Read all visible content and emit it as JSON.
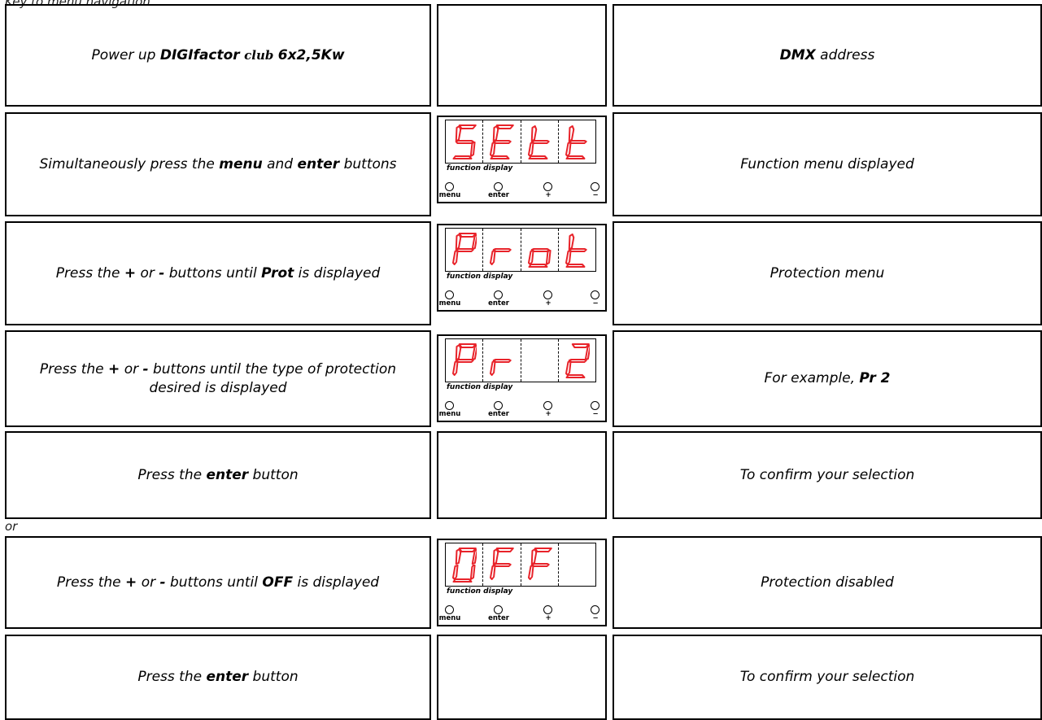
{
  "header": {
    "text": "Key to menu navigation"
  },
  "panel_labels": {
    "function_display": "function display",
    "menu": "menu",
    "enter": "enter",
    "plus": "+",
    "minus": "−"
  },
  "separator": {
    "text": "or"
  },
  "display_colors": {
    "segment": "#e8232a"
  },
  "rows": [
    {
      "left": {
        "pre": "Power up ",
        "b1": "DIGIfactor",
        "mid": " ",
        "club": "club",
        "mid2": " ",
        "b2": "6x2,5Kw",
        "post": ""
      },
      "right": {
        "pre": "",
        "b1": "DMX",
        "post": " address"
      }
    },
    {
      "left": {
        "pre": "Simultaneously press the ",
        "b1": "menu",
        "mid": " and ",
        "b2": "enter",
        "post": " buttons"
      },
      "display": [
        "S",
        "E",
        "t",
        "t"
      ],
      "right": {
        "text": "Function menu displayed"
      }
    },
    {
      "left": {
        "pre": "Press the ",
        "b1": "+",
        "mid": " or ",
        "b2": "-",
        "mid2": " buttons until ",
        "b3": "Prot",
        "post": " is displayed"
      },
      "display": [
        "P",
        "r",
        "o",
        "t"
      ],
      "right": {
        "text": "Protection menu"
      }
    },
    {
      "left": {
        "pre": "Press the ",
        "b1": "+",
        "mid": " or ",
        "b2": "-",
        "post": " buttons until the type of protection desired is displayed"
      },
      "display": [
        "P",
        "r",
        "",
        "2"
      ],
      "right": {
        "pre": "For example, ",
        "b1": "Pr 2",
        "post": ""
      }
    },
    {
      "left": {
        "pre": "Press the ",
        "b1": "enter",
        "post": " button"
      },
      "right": {
        "text": "To confirm your selection"
      }
    },
    {
      "left": {
        "pre": "Press the ",
        "b1": "+",
        "mid": " or ",
        "b2": "-",
        "mid2": " buttons until ",
        "b3": "OFF",
        "post": " is displayed"
      },
      "display": [
        "0",
        "F",
        "F",
        ""
      ],
      "right": {
        "text": "Protection disabled"
      }
    },
    {
      "left": {
        "pre": "Press the ",
        "b1": "enter",
        "post": " button"
      },
      "right": {
        "text": "To confirm your selection"
      }
    }
  ]
}
